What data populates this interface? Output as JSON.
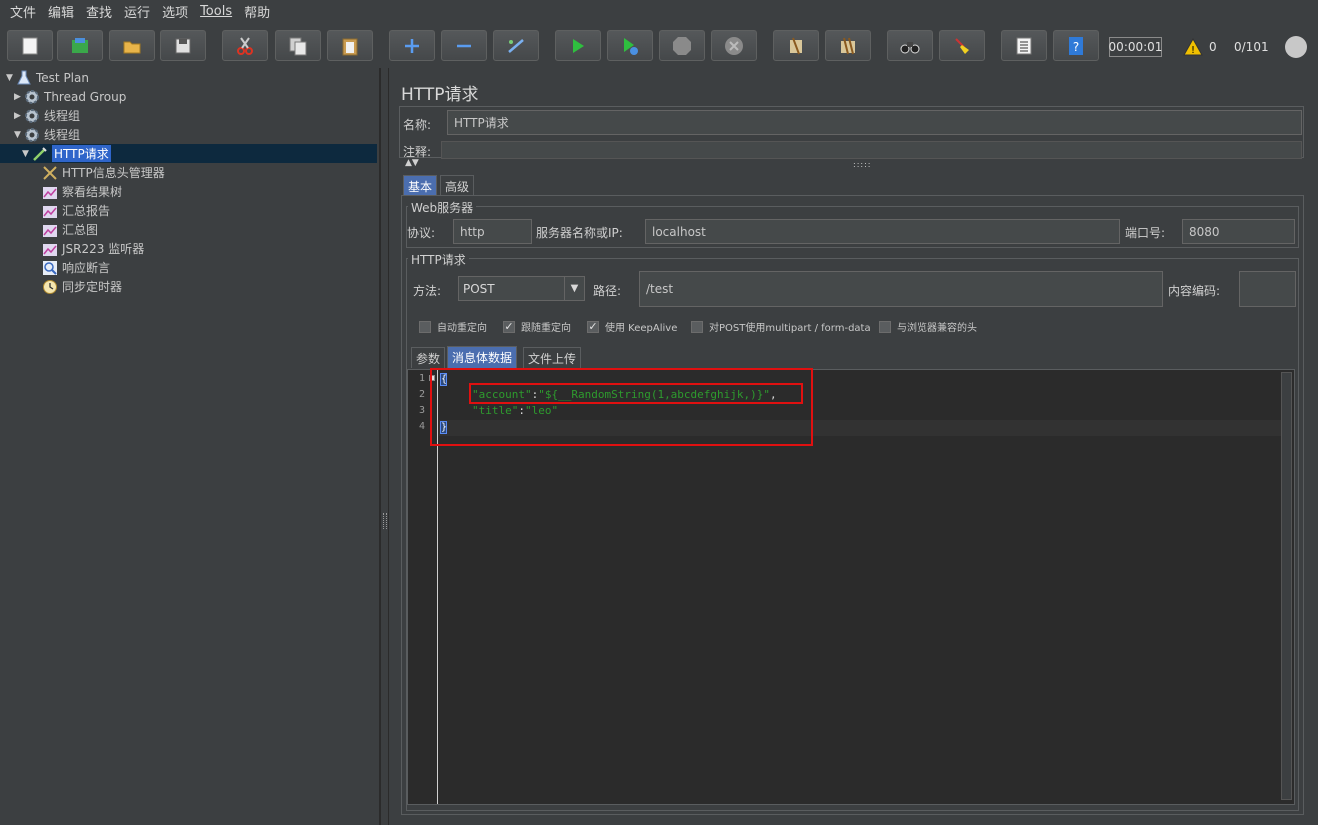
{
  "menu": [
    {
      "label": "文件"
    },
    {
      "label": "编辑"
    },
    {
      "label": "查找"
    },
    {
      "label": "运行"
    },
    {
      "label": "选项"
    },
    {
      "label": "Tools"
    },
    {
      "label": "帮助"
    }
  ],
  "toolbar": {
    "buttons": [
      "new-icon",
      "templates-icon",
      "open-icon",
      "save-icon",
      "cut-icon",
      "copy-icon",
      "paste-icon",
      "expand-icon",
      "collapse-icon",
      "toggle-icon",
      "start-icon",
      "start-no-pause-icon",
      "stop-icon",
      "shutdown-icon",
      "clear-icon",
      "clear-all-icon",
      "search-icon",
      "reset-search-icon",
      "function-helper-icon",
      "help-icon"
    ],
    "timer": "00:00:01",
    "warnings": "0",
    "threads": "0/101"
  },
  "tree": [
    {
      "label": "Test Plan"
    },
    {
      "label": "Thread Group"
    },
    {
      "label": "线程组"
    },
    {
      "label": "线程组"
    },
    {
      "label": "HTTP请求"
    },
    {
      "label": "HTTP信息头管理器"
    },
    {
      "label": "察看结果树"
    },
    {
      "label": "汇总报告"
    },
    {
      "label": "汇总图"
    },
    {
      "label": "JSR223 监听器"
    },
    {
      "label": "响应断言"
    },
    {
      "label": "同步定时器"
    }
  ],
  "panel": {
    "title": "HTTP请求",
    "name_label": "名称:",
    "name_value": "HTTP请求",
    "comment_label": "注释:",
    "tabs": [
      "基本",
      "高级"
    ],
    "web_server_label": "Web服务器",
    "protocol_label": "协议:",
    "protocol_value": "http",
    "server_label": "服务器名称或IP:",
    "server_value": "localhost",
    "port_label": "端口号:",
    "port_value": "8080",
    "http_request_label": "HTTP请求",
    "method_label": "方法:",
    "method_value": "POST",
    "path_label": "路径:",
    "path_value": "/test",
    "encoding_label": "内容编码:",
    "encoding_value": "",
    "checkboxes": [
      {
        "label": "自动重定向",
        "checked": false
      },
      {
        "label": "跟随重定向",
        "checked": true
      },
      {
        "label": "使用 KeepAlive",
        "checked": true
      },
      {
        "label": "对POST使用multipart / form-data",
        "checked": false
      },
      {
        "label": "与浏览器兼容的头",
        "checked": false
      }
    ],
    "body_tabs": [
      "参数",
      "消息体数据",
      "文件上传"
    ],
    "code": {
      "line_numbers": [
        "1",
        "2",
        "3",
        "4"
      ],
      "open_brace": "{",
      "close_brace": "}",
      "line2_key": "\"account\"",
      "line2_sep": ":",
      "line2_value": "\"${__RandomString(1,abcdefghijk,)}\"",
      "line2_comma": ",",
      "line3_key": "\"title\"",
      "line3_sep": ":",
      "line3_value": "\"leo\""
    }
  }
}
